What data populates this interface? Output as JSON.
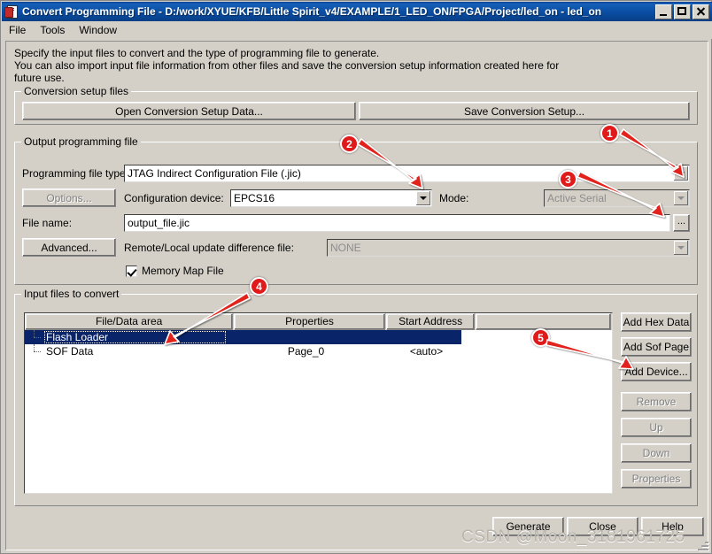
{
  "window": {
    "title": "Convert Programming File - D:/work/XYUE/KFB/Little Spirit_v4/EXAMPLE/1_LED_ON/FPGA/Project/led_on - led_on",
    "icon": "convert-file-icon",
    "buttons": {
      "minimize": "_",
      "maximize": "□",
      "close": "×"
    }
  },
  "menubar": {
    "items": [
      "File",
      "Tools",
      "Window"
    ]
  },
  "intro": {
    "line1": "Specify the input files to convert and the type of programming file to generate.",
    "line2": "You can also import input file information from other files and save the conversion setup information created here for",
    "line3": "future use."
  },
  "conversion_setup": {
    "legend": "Conversion setup files",
    "open_button": "Open Conversion Setup Data...",
    "save_button": "Save Conversion Setup..."
  },
  "output_programming_file": {
    "legend": "Output programming file",
    "programming_file_type_label": "Programming file type:",
    "programming_file_type_value": "JTAG Indirect Configuration File (.jic)",
    "options_button": "Options...",
    "configuration_device_label": "Configuration device:",
    "configuration_device_value": "EPCS16",
    "mode_label": "Mode:",
    "mode_value": "Active Serial",
    "file_name_label": "File name:",
    "file_name_value": "output_file.jic",
    "browse_button": "...",
    "advanced_button": "Advanced...",
    "remote_local_label": "Remote/Local update difference file:",
    "remote_local_value": "NONE",
    "memory_map_label": "Memory Map File",
    "memory_map_checked": true
  },
  "input_files": {
    "legend": "Input files to convert",
    "columns": [
      "File/Data area",
      "Properties",
      "Start Address"
    ],
    "rows": [
      {
        "name": "Flash Loader",
        "properties": "",
        "start_address": "",
        "selected": true
      },
      {
        "name": "SOF Data",
        "properties": "Page_0",
        "start_address": "<auto>",
        "selected": false
      }
    ],
    "side_buttons": [
      {
        "label": "Add Hex Data",
        "enabled": true
      },
      {
        "label": "Add Sof Page",
        "enabled": true
      },
      {
        "label": "Add Device...",
        "enabled": true
      },
      {
        "label": "Remove",
        "enabled": false
      },
      {
        "label": "Up",
        "enabled": false
      },
      {
        "label": "Down",
        "enabled": false
      },
      {
        "label": "Properties",
        "enabled": false
      }
    ]
  },
  "footer": {
    "generate": "Generate",
    "close": "Close",
    "help": "Help"
  },
  "annotations": {
    "markers": [
      {
        "id": "1",
        "label": "1"
      },
      {
        "id": "2",
        "label": "2"
      },
      {
        "id": "3",
        "label": "3"
      },
      {
        "id": "4",
        "label": "4"
      },
      {
        "id": "5",
        "label": "5"
      }
    ],
    "color": "#e01a1a"
  },
  "watermark": {
    "text": "CSDN @Moon_3181961725"
  }
}
